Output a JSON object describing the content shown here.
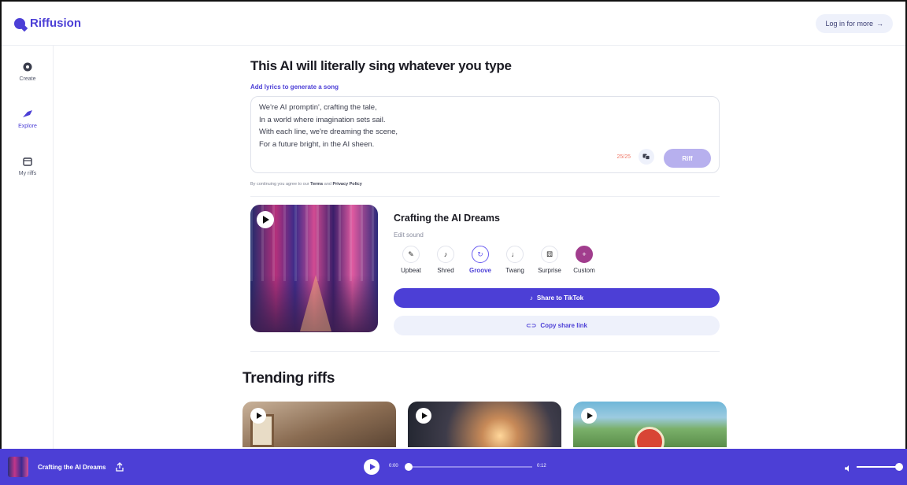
{
  "app": {
    "brand": "Riffusion",
    "login_label": "Log in for more",
    "accent_color": "#4c3fd6"
  },
  "sidebar": {
    "items": [
      {
        "label": "Create",
        "icon": "create-icon"
      },
      {
        "label": "Explore",
        "icon": "explore-icon"
      },
      {
        "label": "My riffs",
        "icon": "my-riffs-icon"
      }
    ]
  },
  "composer": {
    "headline": "This AI will literally sing whatever you type",
    "lyrics_label": "Add lyrics to generate a song",
    "lyrics": "We're AI promptin', crafting the tale,\nIn a world where imagination sets sail.\nWith each line, we're dreaming the scene,\nFor a future bright, in the AI sheen.",
    "char_count": "25/25",
    "riff_label": "Riff",
    "terms_prefix": "By continuing you agree to our",
    "terms_link": "Terms",
    "terms_and": "and",
    "privacy_link": "Privacy Policy"
  },
  "song": {
    "title": "Crafting the AI Dreams",
    "edit_label": "Edit sound",
    "styles": [
      {
        "label": "Upbeat",
        "icon": "upbeat-icon",
        "glyph": "✎"
      },
      {
        "label": "Shred",
        "icon": "shred-icon",
        "glyph": "♪"
      },
      {
        "label": "Groove",
        "icon": "groove-icon",
        "glyph": "↻",
        "selected": true
      },
      {
        "label": "Twang",
        "icon": "twang-icon",
        "glyph": "♩"
      },
      {
        "label": "Surprise",
        "icon": "surprise-icon",
        "glyph": "⚄"
      },
      {
        "label": "Custom",
        "icon": "plus-icon",
        "glyph": "+"
      }
    ],
    "share_label": "Share to TikTok",
    "copy_label": "Copy share link"
  },
  "trending": {
    "heading": "Trending riffs"
  },
  "player": {
    "title": "Crafting the AI Dreams",
    "current_time": "0:00",
    "duration": "0:12",
    "volume": 1.0
  }
}
